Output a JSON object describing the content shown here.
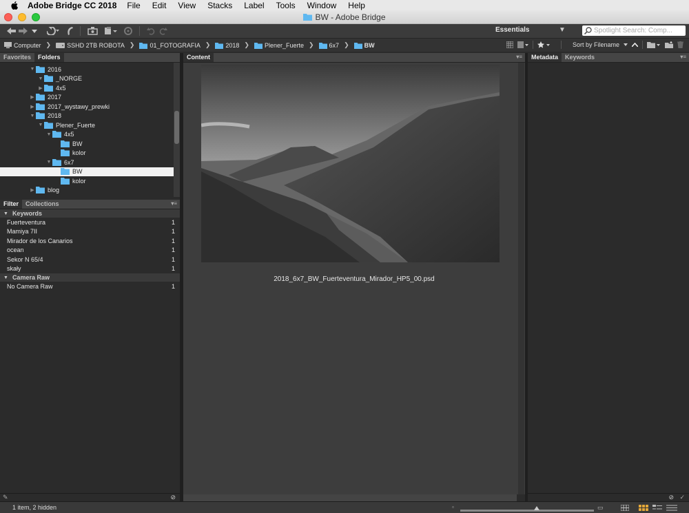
{
  "menubar": {
    "app": "Adobe Bridge CC 2018",
    "items": [
      "File",
      "Edit",
      "View",
      "Stacks",
      "Label",
      "Tools",
      "Window",
      "Help"
    ]
  },
  "window": {
    "title": "BW - Adobe Bridge"
  },
  "toolbar": {
    "workspace": "Essentials",
    "search_placeholder": "Spotlight Search: Comp..."
  },
  "pathbar": {
    "crumbs": [
      "Computer",
      "SSHD 2TB ROBOTA",
      "01_FOTOGRAFIA",
      "2018",
      "Plener_Fuerte",
      "6x7",
      "BW"
    ],
    "sort": "Sort by Filename"
  },
  "left_panel": {
    "tabs": [
      "Favorites",
      "Folders"
    ],
    "folders": [
      {
        "label": "2016"
      },
      {
        "label": "_NORGE"
      },
      {
        "label": "4x5"
      },
      {
        "label": "2017"
      },
      {
        "label": "2017_wystawy_prewki"
      },
      {
        "label": "2018"
      },
      {
        "label": "Plener_Fuerte"
      },
      {
        "label": "4x5"
      },
      {
        "label": "BW"
      },
      {
        "label": "kolor"
      },
      {
        "label": "6x7"
      },
      {
        "label": "BW"
      },
      {
        "label": "kolor"
      },
      {
        "label": "blog"
      }
    ]
  },
  "filter_panel": {
    "tabs": [
      "Filter",
      "Collections"
    ],
    "sections": [
      {
        "title": "Keywords",
        "items": [
          {
            "label": "Fuerteventura",
            "count": "1"
          },
          {
            "label": "Mamiya 7II",
            "count": "1"
          },
          {
            "label": "Mirador de los Canarios",
            "count": "1"
          },
          {
            "label": "ocean",
            "count": "1"
          },
          {
            "label": "Sekor N 65/4",
            "count": "1"
          },
          {
            "label": "skały",
            "count": "1"
          }
        ]
      },
      {
        "title": "Camera Raw",
        "items": [
          {
            "label": "No Camera Raw",
            "count": "1"
          }
        ]
      }
    ]
  },
  "content_panel": {
    "tab": "Content",
    "filename": "2018_6x7_BW_Fuerteventura_Mirador_HP5_00.psd"
  },
  "right_panel": {
    "tabs": [
      "Metadata",
      "Keywords"
    ]
  },
  "status": {
    "text": "1 item, 2 hidden",
    "zoom_fraction": 0.57
  },
  "colors": {
    "folder": "#5fb8f0",
    "selected_row": "#f2f2f2"
  }
}
